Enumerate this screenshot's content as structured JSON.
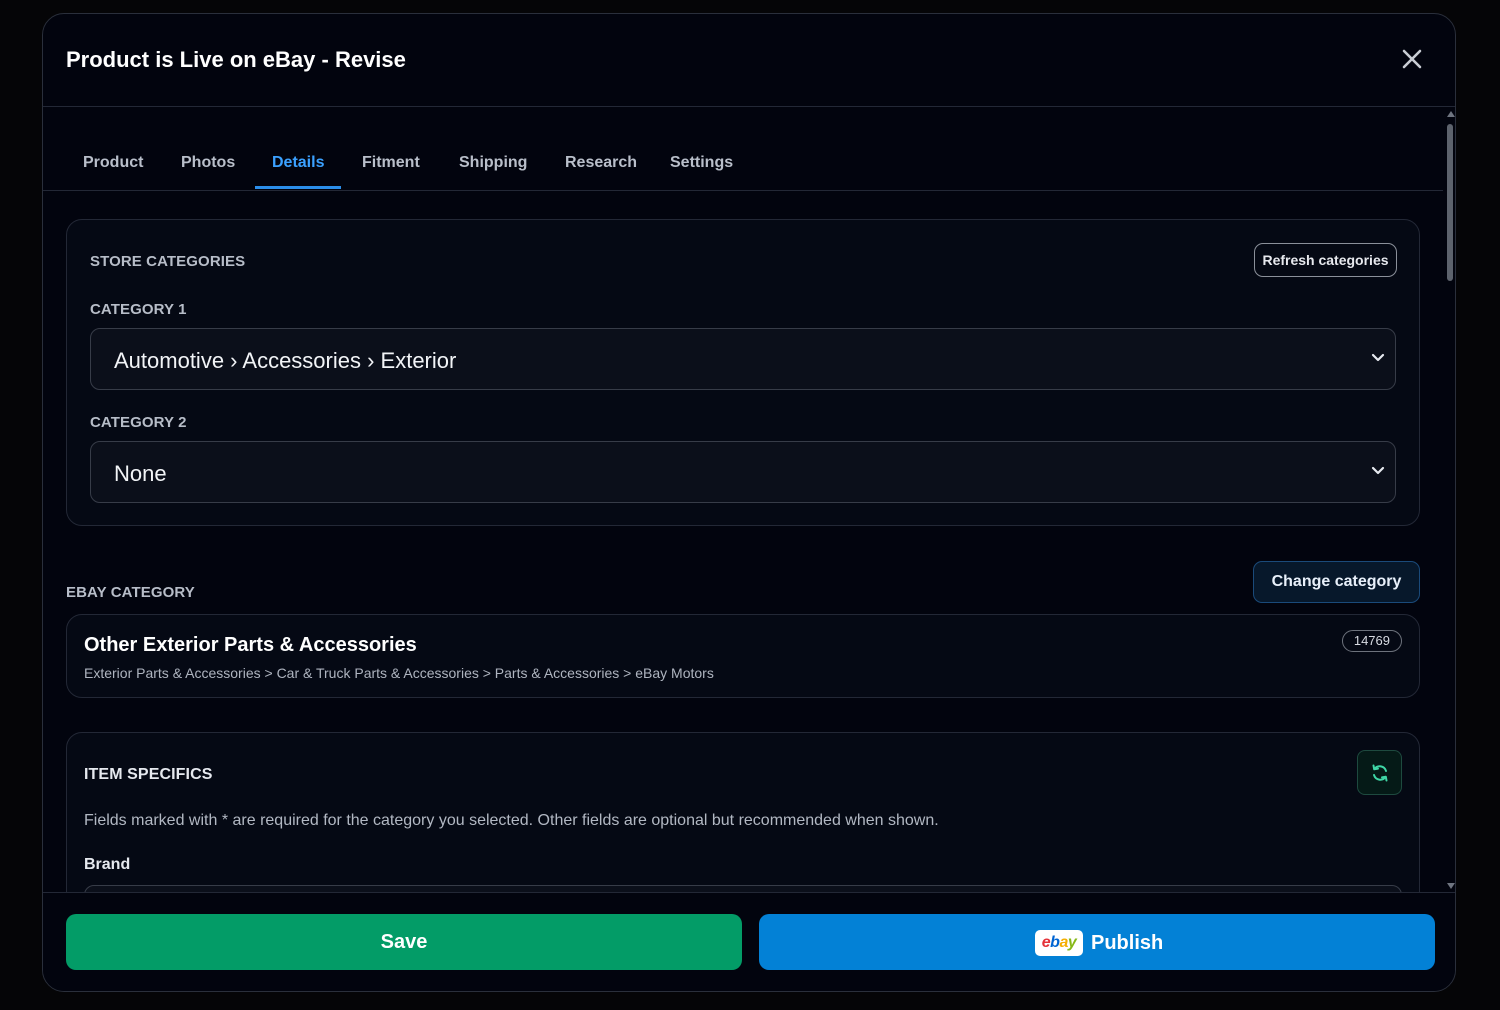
{
  "modal": {
    "title": "Product is Live on eBay - Revise"
  },
  "tabs": [
    {
      "label": "Product"
    },
    {
      "label": "Photos"
    },
    {
      "label": "Details"
    },
    {
      "label": "Fitment"
    },
    {
      "label": "Shipping"
    },
    {
      "label": "Research"
    },
    {
      "label": "Settings"
    }
  ],
  "active_tab": "Details",
  "store_categories": {
    "heading": "STORE CATEGORIES",
    "refresh_label": "Refresh categories",
    "category1_label": "CATEGORY 1",
    "category1_value": "Automotive › Accessories › Exterior",
    "category2_label": "CATEGORY 2",
    "category2_value": "None"
  },
  "ebay_category": {
    "heading": "EBAY CATEGORY",
    "change_label": "Change category",
    "name": "Other Exterior Parts & Accessories",
    "path": "Exterior Parts & Accessories > Car & Truck Parts & Accessories > Parts & Accessories > eBay Motors",
    "id": "14769"
  },
  "item_specifics": {
    "heading": "ITEM SPECIFICS",
    "description": "Fields marked with * are required for the category you selected. Other fields are optional but recommended when shown.",
    "first_field_label": "Brand"
  },
  "footer": {
    "save_label": "Save",
    "publish_label": "Publish",
    "ebay_logo": {
      "e": "e",
      "b": "b",
      "a": "a",
      "y": "y"
    }
  },
  "colors": {
    "accent_tab": "#3ba1ff",
    "save": "#039c67",
    "publish": "#0381d6"
  }
}
